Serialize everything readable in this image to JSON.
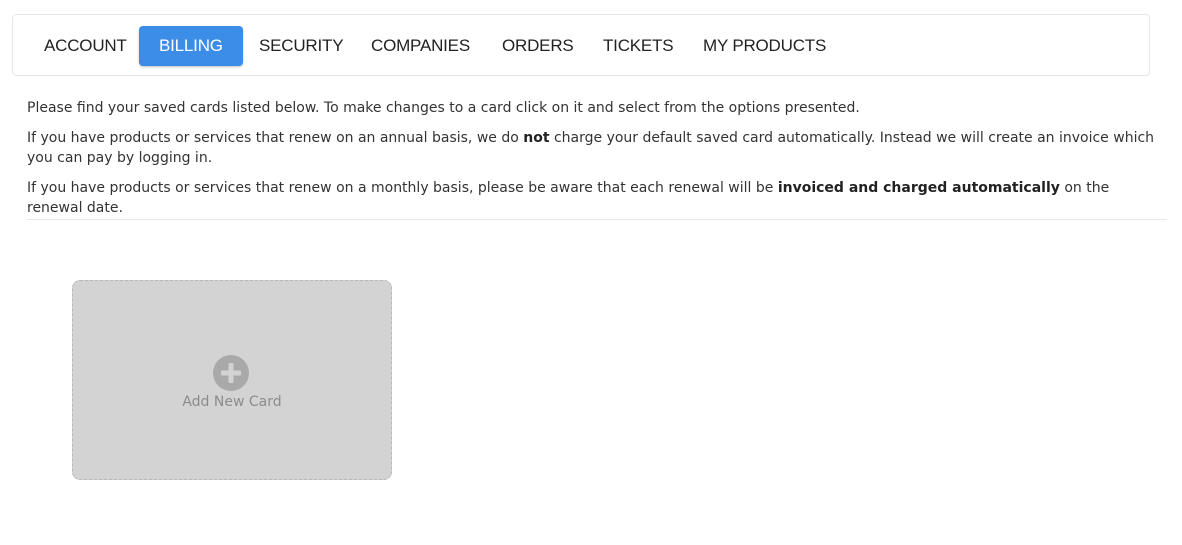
{
  "tabs": [
    {
      "label": "ACCOUNT",
      "active": false
    },
    {
      "label": "BILLING",
      "active": true
    },
    {
      "label": "SECURITY",
      "active": false
    },
    {
      "label": "COMPANIES",
      "active": false
    },
    {
      "label": "ORDERS",
      "active": false
    },
    {
      "label": "TICKETS",
      "active": false
    },
    {
      "label": "MY PRODUCTS",
      "active": false
    }
  ],
  "info": {
    "line1": "Please find your saved cards listed below. To make changes to a card click on it and select from the options presented.",
    "line2_pre": "If you have products or services that renew on an annual basis, we do ",
    "line2_bold": "not",
    "line2_post": " charge your default saved card automatically. Instead we will create an invoice which you can pay by logging in.",
    "line3_pre": "If you have products or services that renew on a monthly basis, please be aware that each renewal will be ",
    "line3_bold": "invoiced and charged automatically",
    "line3_post": " on the renewal date."
  },
  "add_card": {
    "label": "Add New Card",
    "icon": "plus-circle-icon"
  },
  "colors": {
    "accent": "#3b8de8",
    "card_bg": "#d3d3d3",
    "icon": "#a9a9a9"
  }
}
